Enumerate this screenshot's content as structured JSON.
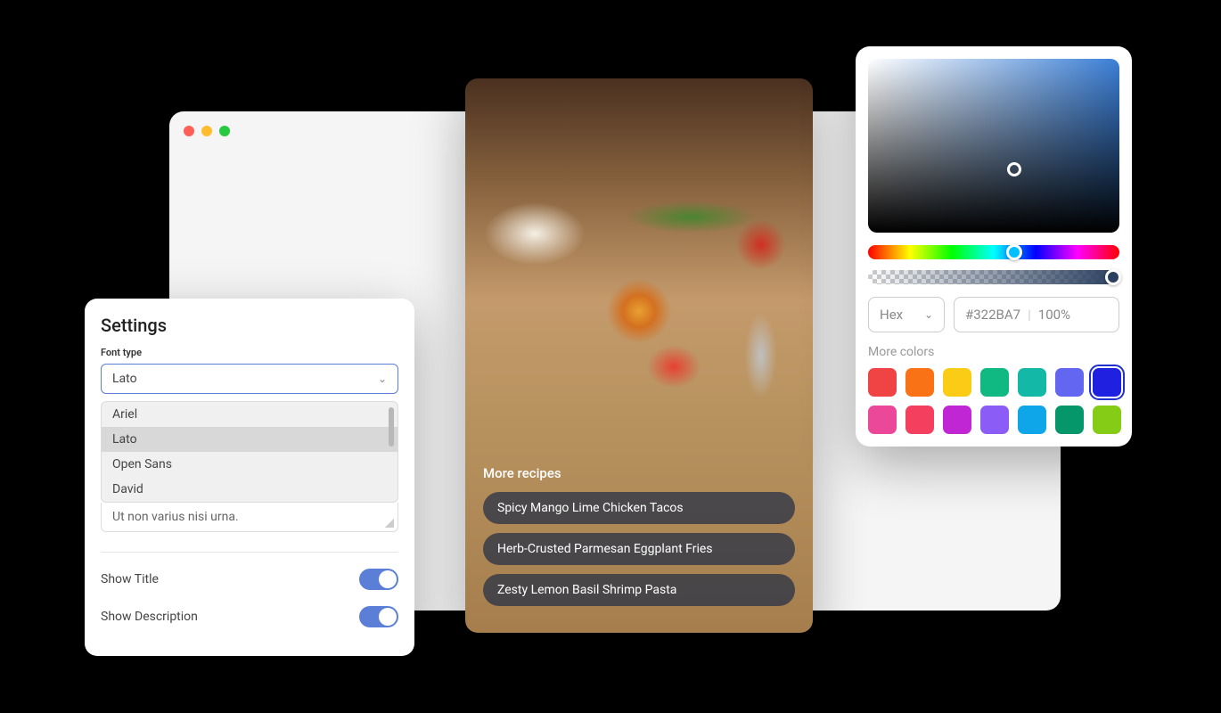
{
  "settings": {
    "title": "Settings",
    "font_type_label": "Font type",
    "selected_font": "Lato",
    "font_options": [
      "Ariel",
      "Lato",
      "Open Sans",
      "David"
    ],
    "text_value": "Ut non varius nisi urna.",
    "show_title_label": "Show Title",
    "show_title": true,
    "show_description_label": "Show Description",
    "show_description": true
  },
  "recipes": {
    "heading": "More recipes",
    "items": [
      "Spicy Mango Lime Chicken Tacos",
      "Herb-Crusted Parmesan Eggplant Fries",
      "Zesty Lemon Basil Shrimp Pasta"
    ]
  },
  "color_picker": {
    "format": "Hex",
    "hex_value": "#322BA7",
    "opacity": "100%",
    "more_colors_label": "More colors",
    "swatches": [
      {
        "color": "#f04343",
        "active": false
      },
      {
        "color": "#f97316",
        "active": false
      },
      {
        "color": "#facc15",
        "active": false
      },
      {
        "color": "#10b981",
        "active": false
      },
      {
        "color": "#14b8a6",
        "active": false
      },
      {
        "color": "#6366f1",
        "active": false
      },
      {
        "color": "#2020e0",
        "active": true
      },
      {
        "color": "#ec4899",
        "active": false
      },
      {
        "color": "#f43f5e",
        "active": false
      },
      {
        "color": "#c026d3",
        "active": false
      },
      {
        "color": "#8b5cf6",
        "active": false
      },
      {
        "color": "#0ea5e9",
        "active": false
      },
      {
        "color": "#059669",
        "active": false
      },
      {
        "color": "#84cc16",
        "active": false
      }
    ]
  }
}
